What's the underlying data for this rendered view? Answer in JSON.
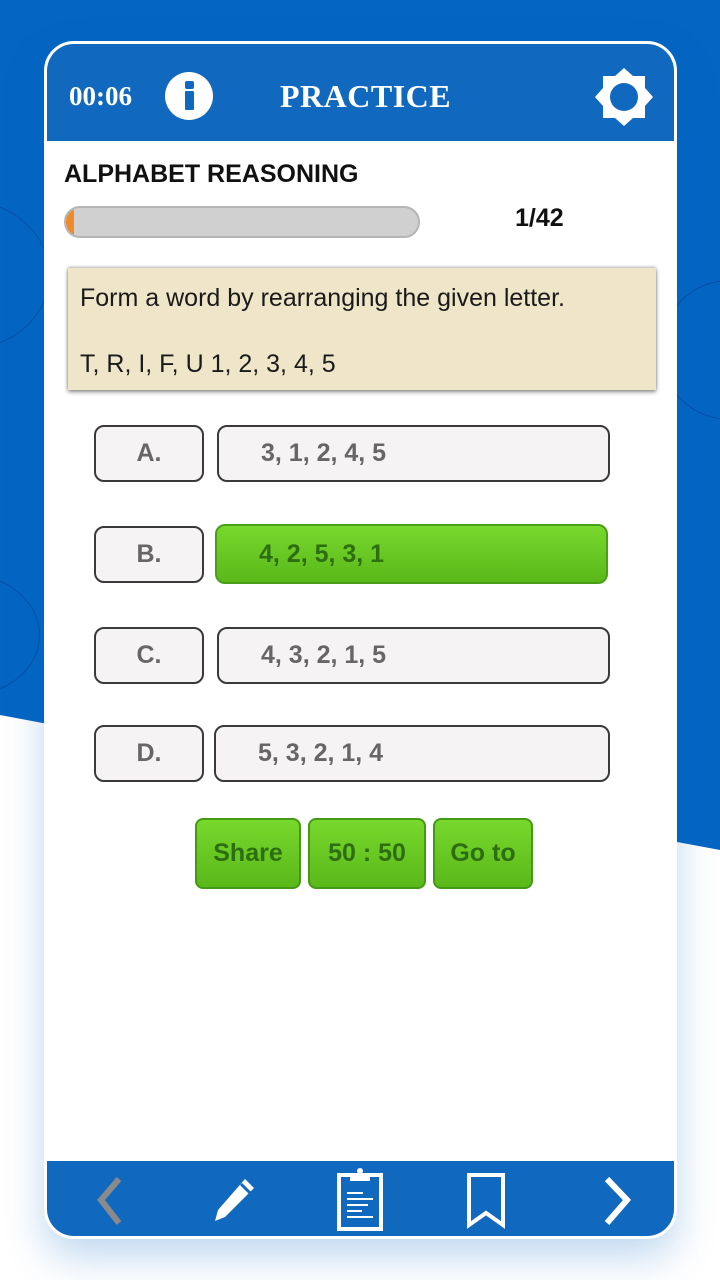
{
  "header": {
    "timer": "00:06",
    "title": "PRACTICE",
    "info_icon": "info-icon",
    "settings_icon": "settings-gear-icon"
  },
  "quiz": {
    "section_title": "ALPHABET REASONING",
    "progress_fraction": 0.024,
    "counter": "1/42",
    "question_line1": "Form a word by rearranging the given letter.",
    "question_line2": "T, R, I, F, U 1, 2, 3, 4, 5"
  },
  "options": [
    {
      "letter": "A.",
      "answer": "3, 1, 2, 4, 5",
      "selected": false
    },
    {
      "letter": "B.",
      "answer": "4, 2, 5, 3, 1",
      "selected": true
    },
    {
      "letter": "C.",
      "answer": "4, 3, 2, 1, 5",
      "selected": false
    },
    {
      "letter": "D.",
      "answer": "5, 3, 2, 1, 4",
      "selected": false
    }
  ],
  "actions": {
    "share": "Share",
    "fifty_fifty": "50 : 50",
    "goto": "Go to"
  },
  "footer": {
    "icons": [
      "chevron-left-icon",
      "pencil-icon",
      "clipboard-icon",
      "bookmark-icon",
      "chevron-right-icon"
    ]
  },
  "colors": {
    "brand_blue": "#1169bf",
    "background_blue": "#0565c2",
    "selected_green": "#6ac922",
    "progress_orange": "#f08a2a",
    "question_bg": "#efe5c8"
  }
}
